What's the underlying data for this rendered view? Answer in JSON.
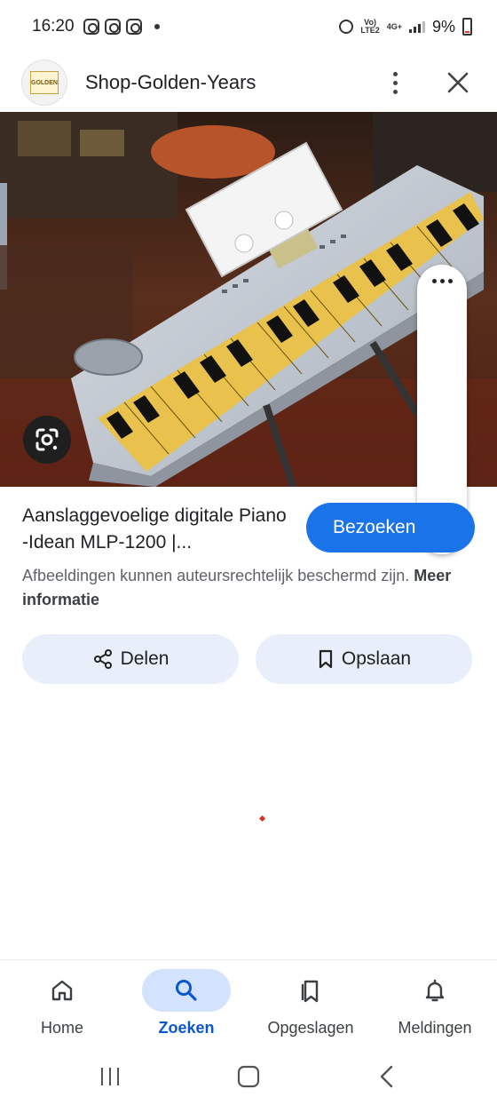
{
  "status_bar": {
    "time": "16:20",
    "network_top": "Vo)",
    "network_bottom": "LTE2",
    "network_type": "4G+",
    "battery": "9%"
  },
  "header": {
    "site_title": "Shop-Golden-Years",
    "logo_text": "GOLDEN"
  },
  "image": {
    "description_icon": "google-lens-icon"
  },
  "result": {
    "title": "Aanslaggevoelige digitale Piano -Idean MLP-1200 |...",
    "visit_label": "Bezoeken",
    "copyright_text": "Afbeeldingen kunnen auteursrechtelijk beschermd zijn.",
    "more_info_label": "Meer informatie"
  },
  "actions": {
    "share_label": "Delen",
    "save_label": "Opslaan"
  },
  "bottom_nav": {
    "items": [
      {
        "label": "Home",
        "icon": "home-icon",
        "active": false
      },
      {
        "label": "Zoeken",
        "icon": "search-icon",
        "active": true
      },
      {
        "label": "Opgeslagen",
        "icon": "bookmarks-icon",
        "active": false
      },
      {
        "label": "Meldingen",
        "icon": "bell-icon",
        "active": false
      }
    ]
  },
  "colors": {
    "accent": "#1a73e8",
    "chip_bg": "#e8effa",
    "nav_active_bg": "#d3e3fd",
    "nav_active_text": "#0b57d0"
  }
}
